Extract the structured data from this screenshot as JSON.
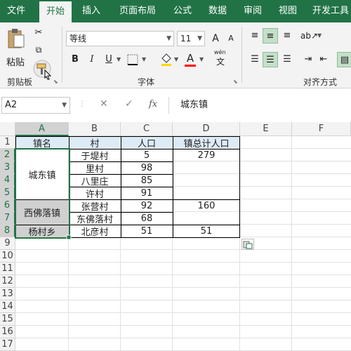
{
  "tabs": [
    "文件",
    "开始",
    "插入",
    "页面布局",
    "公式",
    "数据",
    "审阅",
    "视图",
    "开发工具"
  ],
  "active_tab": "开始",
  "ribbon": {
    "clipboard": {
      "paste_label": "粘贴",
      "group_label": "剪贴板"
    },
    "font": {
      "font_name": "等线",
      "font_size": "11",
      "bold": "B",
      "italic": "I",
      "underline": "U",
      "grow": "A",
      "shrink": "A",
      "font_color_glyph": "A",
      "wen_label": "wén",
      "wen_char": "文",
      "group_label": "字体"
    },
    "alignment": {
      "group_label": "对齐方式"
    }
  },
  "formula_bar": {
    "name_box": "A2",
    "content": "城东镇",
    "fx": "fx",
    "cancel": "✕",
    "enter": "✓"
  },
  "columns": [
    "A",
    "B",
    "C",
    "D",
    "E",
    "F"
  ],
  "rows": [
    "1",
    "2",
    "3",
    "4",
    "5",
    "6",
    "7",
    "8",
    "9",
    "10",
    "11",
    "12",
    "13",
    "14",
    "15",
    "16",
    "17"
  ],
  "table": {
    "headers": [
      "镇名",
      "村",
      "人口",
      "镇总计人口"
    ],
    "towns": [
      "城东镇",
      "西佛落镇",
      "杨村乡"
    ],
    "villages": [
      "于堤村",
      "里村",
      "八里庄",
      "许村",
      "张营村",
      "东佛落村",
      "北彦村"
    ],
    "population": [
      "5",
      "98",
      "85",
      "91",
      "92",
      "68",
      "51"
    ],
    "town_totals": [
      "279",
      "160",
      "51"
    ]
  },
  "colors": {
    "excel_green": "#217346",
    "selection_fill": "#d0d0d0",
    "header_fill": "#ddebf7"
  }
}
